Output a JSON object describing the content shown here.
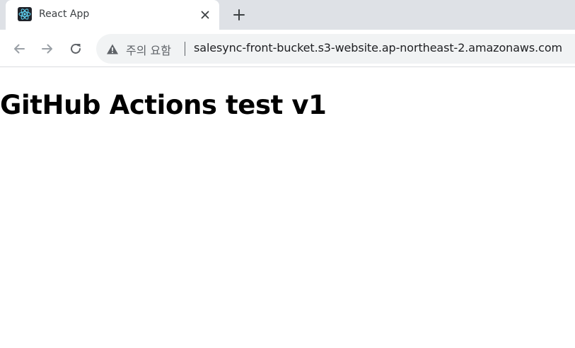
{
  "browser": {
    "tab": {
      "title": "React App",
      "favicon_icon": "react-logo-icon",
      "close_icon": "close-icon"
    },
    "new_tab_icon": "plus-icon",
    "toolbar": {
      "back_icon": "arrow-left-icon",
      "forward_icon": "arrow-right-icon",
      "reload_icon": "reload-icon"
    },
    "omnibox": {
      "security_icon": "warning-triangle-icon",
      "security_label": "주의 요함",
      "url": "salesync-front-bucket.s3-website.ap-northeast-2.amazonaws.com"
    }
  },
  "page": {
    "heading": "GitHub Actions test v1"
  },
  "colors": {
    "tabstrip": "#dee1e6",
    "react_cyan": "#61dafb",
    "icon_gray": "#5f6368",
    "disabled_gray": "#9aa0a6"
  }
}
